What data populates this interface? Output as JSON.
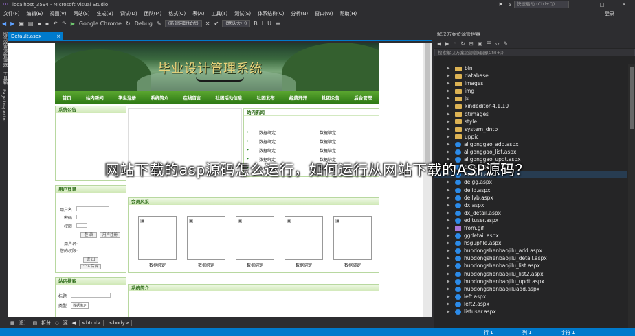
{
  "window": {
    "title": "localhost_3594 - Microsoft Visual Studio",
    "quick_launch": "快速启动 (Ctrl+Q)",
    "login": "登录",
    "notification_count": "5"
  },
  "menu": [
    "文件(F)",
    "编辑(E)",
    "视图(V)",
    "网站(S)",
    "生成(B)",
    "调试(D)",
    "团队(M)",
    "格式(O)",
    "表(A)",
    "工具(T)",
    "测试(S)",
    "体系结构(C)",
    "分析(N)",
    "窗口(W)",
    "帮助(H)"
  ],
  "toolbar": {
    "browser": "Google Chrome",
    "config": "Debug",
    "style_dropdown": "(新建内联样式)",
    "font_dropdown": "(默认大小)"
  },
  "left_strip": [
    "服务器资源管理器",
    "工具箱",
    "Page Inspector"
  ],
  "doc_tab": {
    "name": "Default.aspx",
    "close": "×"
  },
  "site": {
    "banner_title": "毕业设计管理系统",
    "nav": [
      "首页",
      "站内新闻",
      "学生注册",
      "系统简介",
      "在线留言",
      "社团活动信息",
      "社团发布",
      "经费开开",
      "社团公告",
      "后台管理"
    ],
    "notice_title": "系统公告",
    "news_title": "站内新闻",
    "news_rows": [
      [
        "数据绑定",
        "数据绑定"
      ],
      [
        "数据绑定",
        "数据绑定"
      ],
      [
        "数据绑定",
        "数据绑定"
      ],
      [
        "数据绑定",
        "数据绑定"
      ],
      [
        "数据绑定",
        "数据绑定"
      ]
    ],
    "login_title": "用户登录",
    "login_user": "用户名",
    "login_pwd": "密码",
    "login_role": "权限",
    "login_btn": "登 录",
    "reset_btn": "用户注册",
    "login_user2": "用户名:",
    "login_role2": "您的权限:",
    "logout_btn": "退 出",
    "center_btn": "个人后台",
    "members_title": "会员风采",
    "members": [
      "数据绑定",
      "数据绑定",
      "数据绑定",
      "数据绑定",
      "数据绑定"
    ],
    "search_title": "站内搜索",
    "search_label": "标题",
    "search_type": "类型",
    "search_option": "数据绑定",
    "intro_title": "系统简介"
  },
  "bottom_bar": {
    "design": "设计",
    "split": "拆分",
    "source": "源",
    "tag_html": "<html>",
    "tag_body": "<body>"
  },
  "solution_explorer": {
    "title": "解决方案资源管理器",
    "search_placeholder": "搜索解决方案资源管理器(Ctrl+;)",
    "items": [
      {
        "name": "bin",
        "type": "folder"
      },
      {
        "name": "database",
        "type": "folder"
      },
      {
        "name": "images",
        "type": "folder"
      },
      {
        "name": "img",
        "type": "folder"
      },
      {
        "name": "js",
        "type": "folder"
      },
      {
        "name": "kindeditor-4.1.10",
        "type": "folder"
      },
      {
        "name": "qtimages",
        "type": "folder"
      },
      {
        "name": "style",
        "type": "folder"
      },
      {
        "name": "system_dntb",
        "type": "folder"
      },
      {
        "name": "uppic",
        "type": "folder"
      },
      {
        "name": "allgonggao_add.aspx",
        "type": "page"
      },
      {
        "name": "allgonggao_list.aspx",
        "type": "page"
      },
      {
        "name": "allgonggao_updt.aspx",
        "type": "page"
      },
      {
        "name": "ckxx.aspx",
        "type": "page"
      },
      {
        "name": "Default.aspx",
        "type": "page"
      },
      {
        "name": "delgg.aspx",
        "type": "page"
      },
      {
        "name": "delid.aspx",
        "type": "page"
      },
      {
        "name": "dellyb.aspx",
        "type": "page"
      },
      {
        "name": "dx.aspx",
        "type": "page"
      },
      {
        "name": "dx_detail.aspx",
        "type": "page"
      },
      {
        "name": "edituser.aspx",
        "type": "page"
      },
      {
        "name": "from.gif",
        "type": "gif"
      },
      {
        "name": "ggdetail.aspx",
        "type": "page"
      },
      {
        "name": "hsgupfile.aspx",
        "type": "page"
      },
      {
        "name": "huodongshenbaojilu_add.aspx",
        "type": "page"
      },
      {
        "name": "huodongshenbaojilu_detail.aspx",
        "type": "page"
      },
      {
        "name": "huodongshenbaojilu_list.aspx",
        "type": "page"
      },
      {
        "name": "huodongshenbaojilu_list2.aspx",
        "type": "page"
      },
      {
        "name": "huodongshenbaojilu_updt.aspx",
        "type": "page"
      },
      {
        "name": "huodongshenbaojiluadd.aspx",
        "type": "page"
      },
      {
        "name": "left.aspx",
        "type": "page"
      },
      {
        "name": "left2.aspx",
        "type": "page"
      },
      {
        "name": "listuser.aspx",
        "type": "page"
      }
    ]
  },
  "status": {
    "row": "行 1",
    "col": "列 1",
    "char": "字符 1"
  },
  "overlay_caption": "网站下载的asp源码怎么运行，如何运行从网站下载的ASP源码？",
  "colors": {
    "accent": "#007acc",
    "site_green": "#3d8c1e",
    "folder": "#dcb253"
  }
}
